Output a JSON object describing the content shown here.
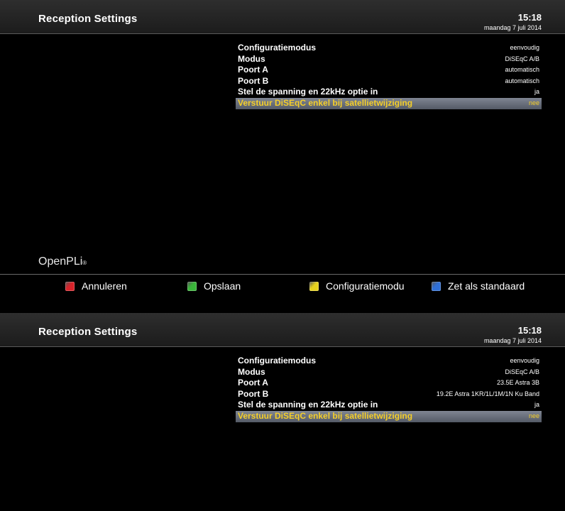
{
  "screen1": {
    "header": {
      "title": "Reception Settings",
      "time": "15:18",
      "date": "maandag 7 juli 2014"
    },
    "settings": [
      {
        "label": "Configuratiemodus",
        "value": "eenvoudig"
      },
      {
        "label": "Modus",
        "value": "DiSEqC A/B"
      },
      {
        "label": "Poort A",
        "value": "automatisch"
      },
      {
        "label": "Poort B",
        "value": "automatisch"
      },
      {
        "label": "Stel de spanning en 22kHz optie in",
        "value": "ja"
      },
      {
        "label": "Verstuur DiSEqC enkel bij satellietwijziging",
        "value": "nee"
      }
    ],
    "logo": {
      "text": "OpenPLi",
      "mark": "®"
    }
  },
  "footer": {
    "buttons": [
      {
        "color": "#d8232a",
        "label": "Annuleren",
        "icon": "red-key-icon"
      },
      {
        "color": "#3ab53a",
        "label": "Opslaan",
        "icon": "green-key-icon"
      },
      {
        "color": "#e6d21e",
        "label": "Configuratiemodu",
        "icon": "yellow-key-icon"
      },
      {
        "color": "#2f6fd6",
        "label": "Zet als standaard",
        "icon": "blue-key-icon"
      }
    ]
  },
  "screen2": {
    "header": {
      "title": "Reception Settings",
      "time": "15:18",
      "date": "maandag 7 juli 2014"
    },
    "settings": [
      {
        "label": "Configuratiemodus",
        "value": "eenvoudig"
      },
      {
        "label": "Modus",
        "value": "DiSEqC A/B"
      },
      {
        "label": "Poort A",
        "value": "23.5E Astra 3B"
      },
      {
        "label": "Poort B",
        "value": "19.2E Astra 1KR/1L/1M/1N Ku Band"
      },
      {
        "label": "Stel de spanning en 22kHz optie in",
        "value": "ja"
      },
      {
        "label": "Verstuur DiSEqC enkel bij satellietwijziging",
        "value": "nee"
      }
    ]
  },
  "selected_index": 5
}
